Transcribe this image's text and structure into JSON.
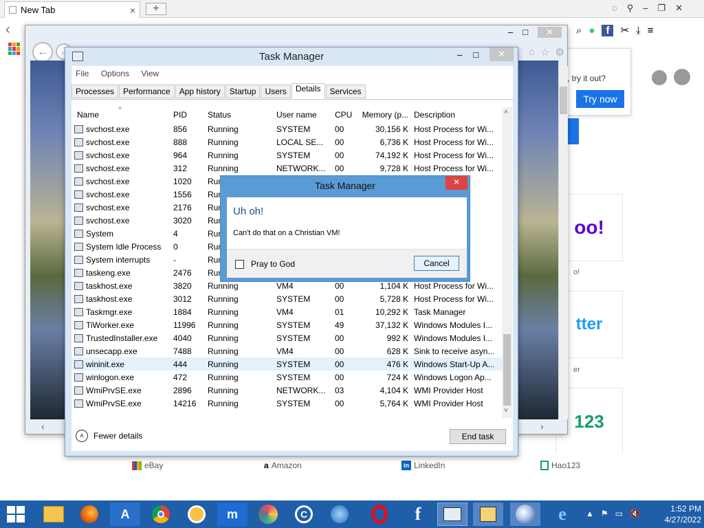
{
  "browser": {
    "tab_title": "New Tab",
    "tab_close": "×",
    "new_tab": "+",
    "extension_text": "s, try it out?",
    "try_now": "Try now",
    "yahoo_tile": "oo!",
    "yahoo_caption": "o!",
    "twitter_tile": "tter",
    "twitter_caption": "er",
    "hao_tile": "123",
    "bottom_links": [
      {
        "label": "eBay",
        "icon": "ebay-bag-icon"
      },
      {
        "label": "Amazon",
        "icon": "amazon-a-icon"
      },
      {
        "label": "LinkedIn",
        "icon": "linkedin-icon"
      },
      {
        "label": "Hao123",
        "icon": "hao123-icon"
      }
    ]
  },
  "task_manager": {
    "title": "Task Manager",
    "menu": [
      "File",
      "Options",
      "View"
    ],
    "tabs": [
      "Processes",
      "Performance",
      "App history",
      "Startup",
      "Users",
      "Details",
      "Services"
    ],
    "active_tab": "Details",
    "columns": [
      "Name",
      "PID",
      "Status",
      "User name",
      "CPU",
      "Memory (p...",
      "Description"
    ],
    "rows": [
      [
        "svchost.exe",
        "856",
        "Running",
        "SYSTEM",
        "00",
        "30,156 K",
        "Host Process for Wi..."
      ],
      [
        "svchost.exe",
        "888",
        "Running",
        "LOCAL SE...",
        "00",
        "6,736 K",
        "Host Process for Wi..."
      ],
      [
        "svchost.exe",
        "964",
        "Running",
        "SYSTEM",
        "00",
        "74,192 K",
        "Host Process for Wi..."
      ],
      [
        "svchost.exe",
        "312",
        "Running",
        "NETWORK...",
        "00",
        "9,728 K",
        "Host Process for Wi..."
      ],
      [
        "svchost.exe",
        "1020",
        "Run",
        "",
        "",
        "",
        "r Wi..."
      ],
      [
        "svchost.exe",
        "1556",
        "Run",
        "",
        "",
        "",
        "r Wi..."
      ],
      [
        "svchost.exe",
        "2176",
        "Run",
        "",
        "",
        "",
        "r Wi..."
      ],
      [
        "svchost.exe",
        "3020",
        "Run",
        "",
        "",
        "",
        "r Wi..."
      ],
      [
        "System",
        "4",
        "Run",
        "",
        "",
        "",
        "stem"
      ],
      [
        "System Idle Process",
        "0",
        "Run",
        "",
        "",
        "",
        "me t..."
      ],
      [
        "System interrupts",
        "-",
        "Run",
        "",
        "",
        "",
        "lure ..."
      ],
      [
        "taskeng.exe",
        "2476",
        "Run",
        "",
        "",
        "",
        "Engi..."
      ],
      [
        "taskhost.exe",
        "3820",
        "Running",
        "VM4",
        "00",
        "1,104 K",
        "Host Process for Wi..."
      ],
      [
        "taskhost.exe",
        "3012",
        "Running",
        "SYSTEM",
        "00",
        "5,728 K",
        "Host Process for Wi..."
      ],
      [
        "Taskmgr.exe",
        "1884",
        "Running",
        "VM4",
        "01",
        "10,292 K",
        "Task Manager"
      ],
      [
        "TiWorker.exe",
        "11996",
        "Running",
        "SYSTEM",
        "49",
        "37,132 K",
        "Windows Modules I..."
      ],
      [
        "TrustedInstaller.exe",
        "4040",
        "Running",
        "SYSTEM",
        "00",
        "992 K",
        "Windows Modules I..."
      ],
      [
        "unsecapp.exe",
        "7488",
        "Running",
        "VM4",
        "00",
        "628 K",
        "Sink to receive asyn..."
      ],
      [
        "wininit.exe",
        "444",
        "Running",
        "SYSTEM",
        "00",
        "476 K",
        "Windows Start-Up A..."
      ],
      [
        "winlogon.exe",
        "472",
        "Running",
        "SYSTEM",
        "00",
        "724 K",
        "Windows Logon Ap..."
      ],
      [
        "WmiPrvSE.exe",
        "2896",
        "Running",
        "NETWORK...",
        "03",
        "4,104 K",
        "WMI Provider Host"
      ],
      [
        "WmiPrvSE.exe",
        "14216",
        "Running",
        "SYSTEM",
        "00",
        "5,764 K",
        "WMI Provider Host"
      ]
    ],
    "selected_row": 18,
    "fewer_details": "Fewer details",
    "end_task": "End task"
  },
  "dialog": {
    "title": "Task Manager",
    "heading": "Uh oh!",
    "message": "Can't do that on a Christian VM!",
    "checkbox_label": "Pray to God",
    "checkbox_checked": false,
    "cancel": "Cancel"
  },
  "taskbar": {
    "time": "1:52 PM",
    "date": "4/27/2022"
  },
  "colors": {
    "dialog_title_bar": "#5b9bd5",
    "close_button": "#e04343",
    "taskbar": "#1f5ea8",
    "heading_blue": "#1e4e8c"
  }
}
